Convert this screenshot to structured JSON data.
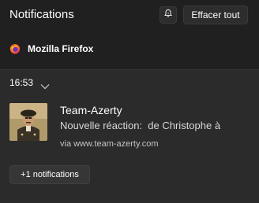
{
  "header": {
    "title": "Notifications",
    "dnd_icon": "focus-bell-icon",
    "clear_all_label": "Effacer tout"
  },
  "app": {
    "name": "Mozilla Firefox",
    "icon": "firefox-icon"
  },
  "notification": {
    "time": "16:53",
    "title": "Team-Azerty",
    "body": "Nouvelle réaction:  de Christophe à",
    "source": "via www.team-azerty.com",
    "avatar": "user-avatar"
  },
  "more_button_label": "+1 notifications",
  "colors": {
    "background": "#202020",
    "card": "#2b2b2b",
    "button": "#2d2d2d"
  }
}
